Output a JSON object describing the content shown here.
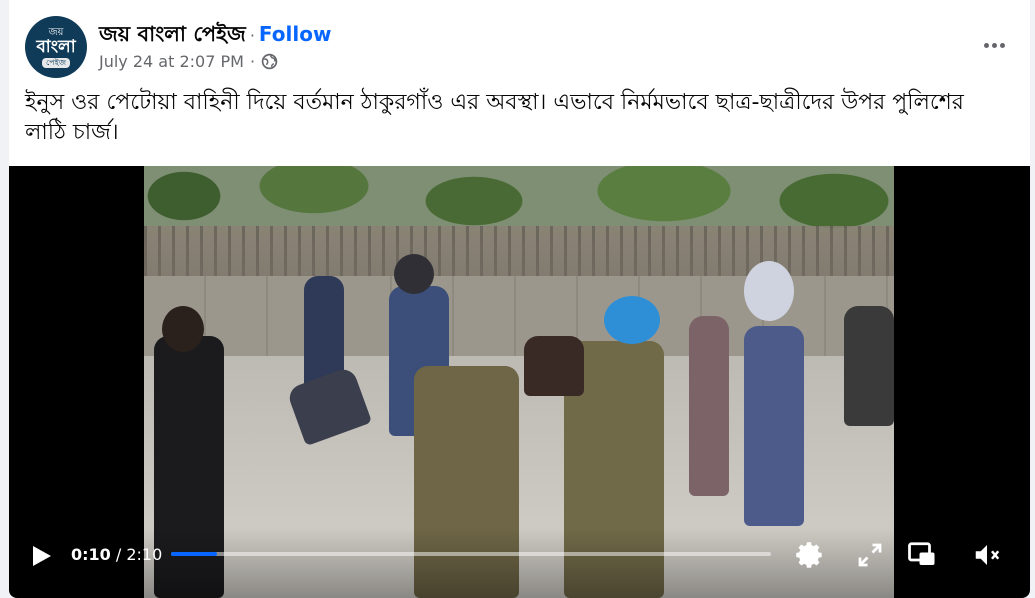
{
  "post": {
    "page_name": "জয় বাংলা পেইজ",
    "separator": "·",
    "follow_label": "Follow",
    "timestamp": "July 24 at 2:07 PM",
    "meta_separator": "·",
    "privacy_icon": "globe-icon",
    "more_icon": "more-options-icon",
    "caption": "ইনুস ওর পেটোয়া বাহিনী দিয়ে বর্তমান ঠাকুরগাঁও এর অবস্থা। এভাবে নির্মমভাবে ছাত্র-ছাত্রীদের উপর পুলিশের লাঠি চার্জ।",
    "avatar": {
      "line1": "জয়",
      "line2": "বাংলা",
      "line3": "পেইজ"
    }
  },
  "video": {
    "current_time": "0:10",
    "time_separator": " / ",
    "duration": "2:10",
    "progress": 0.077,
    "accent_color": "#0866ff",
    "icons": {
      "play": "play-icon",
      "settings": "settings-gear-icon",
      "fullscreen": "expand-icon",
      "pip": "picture-in-picture-icon",
      "volume": "volume-muted-icon"
    }
  }
}
